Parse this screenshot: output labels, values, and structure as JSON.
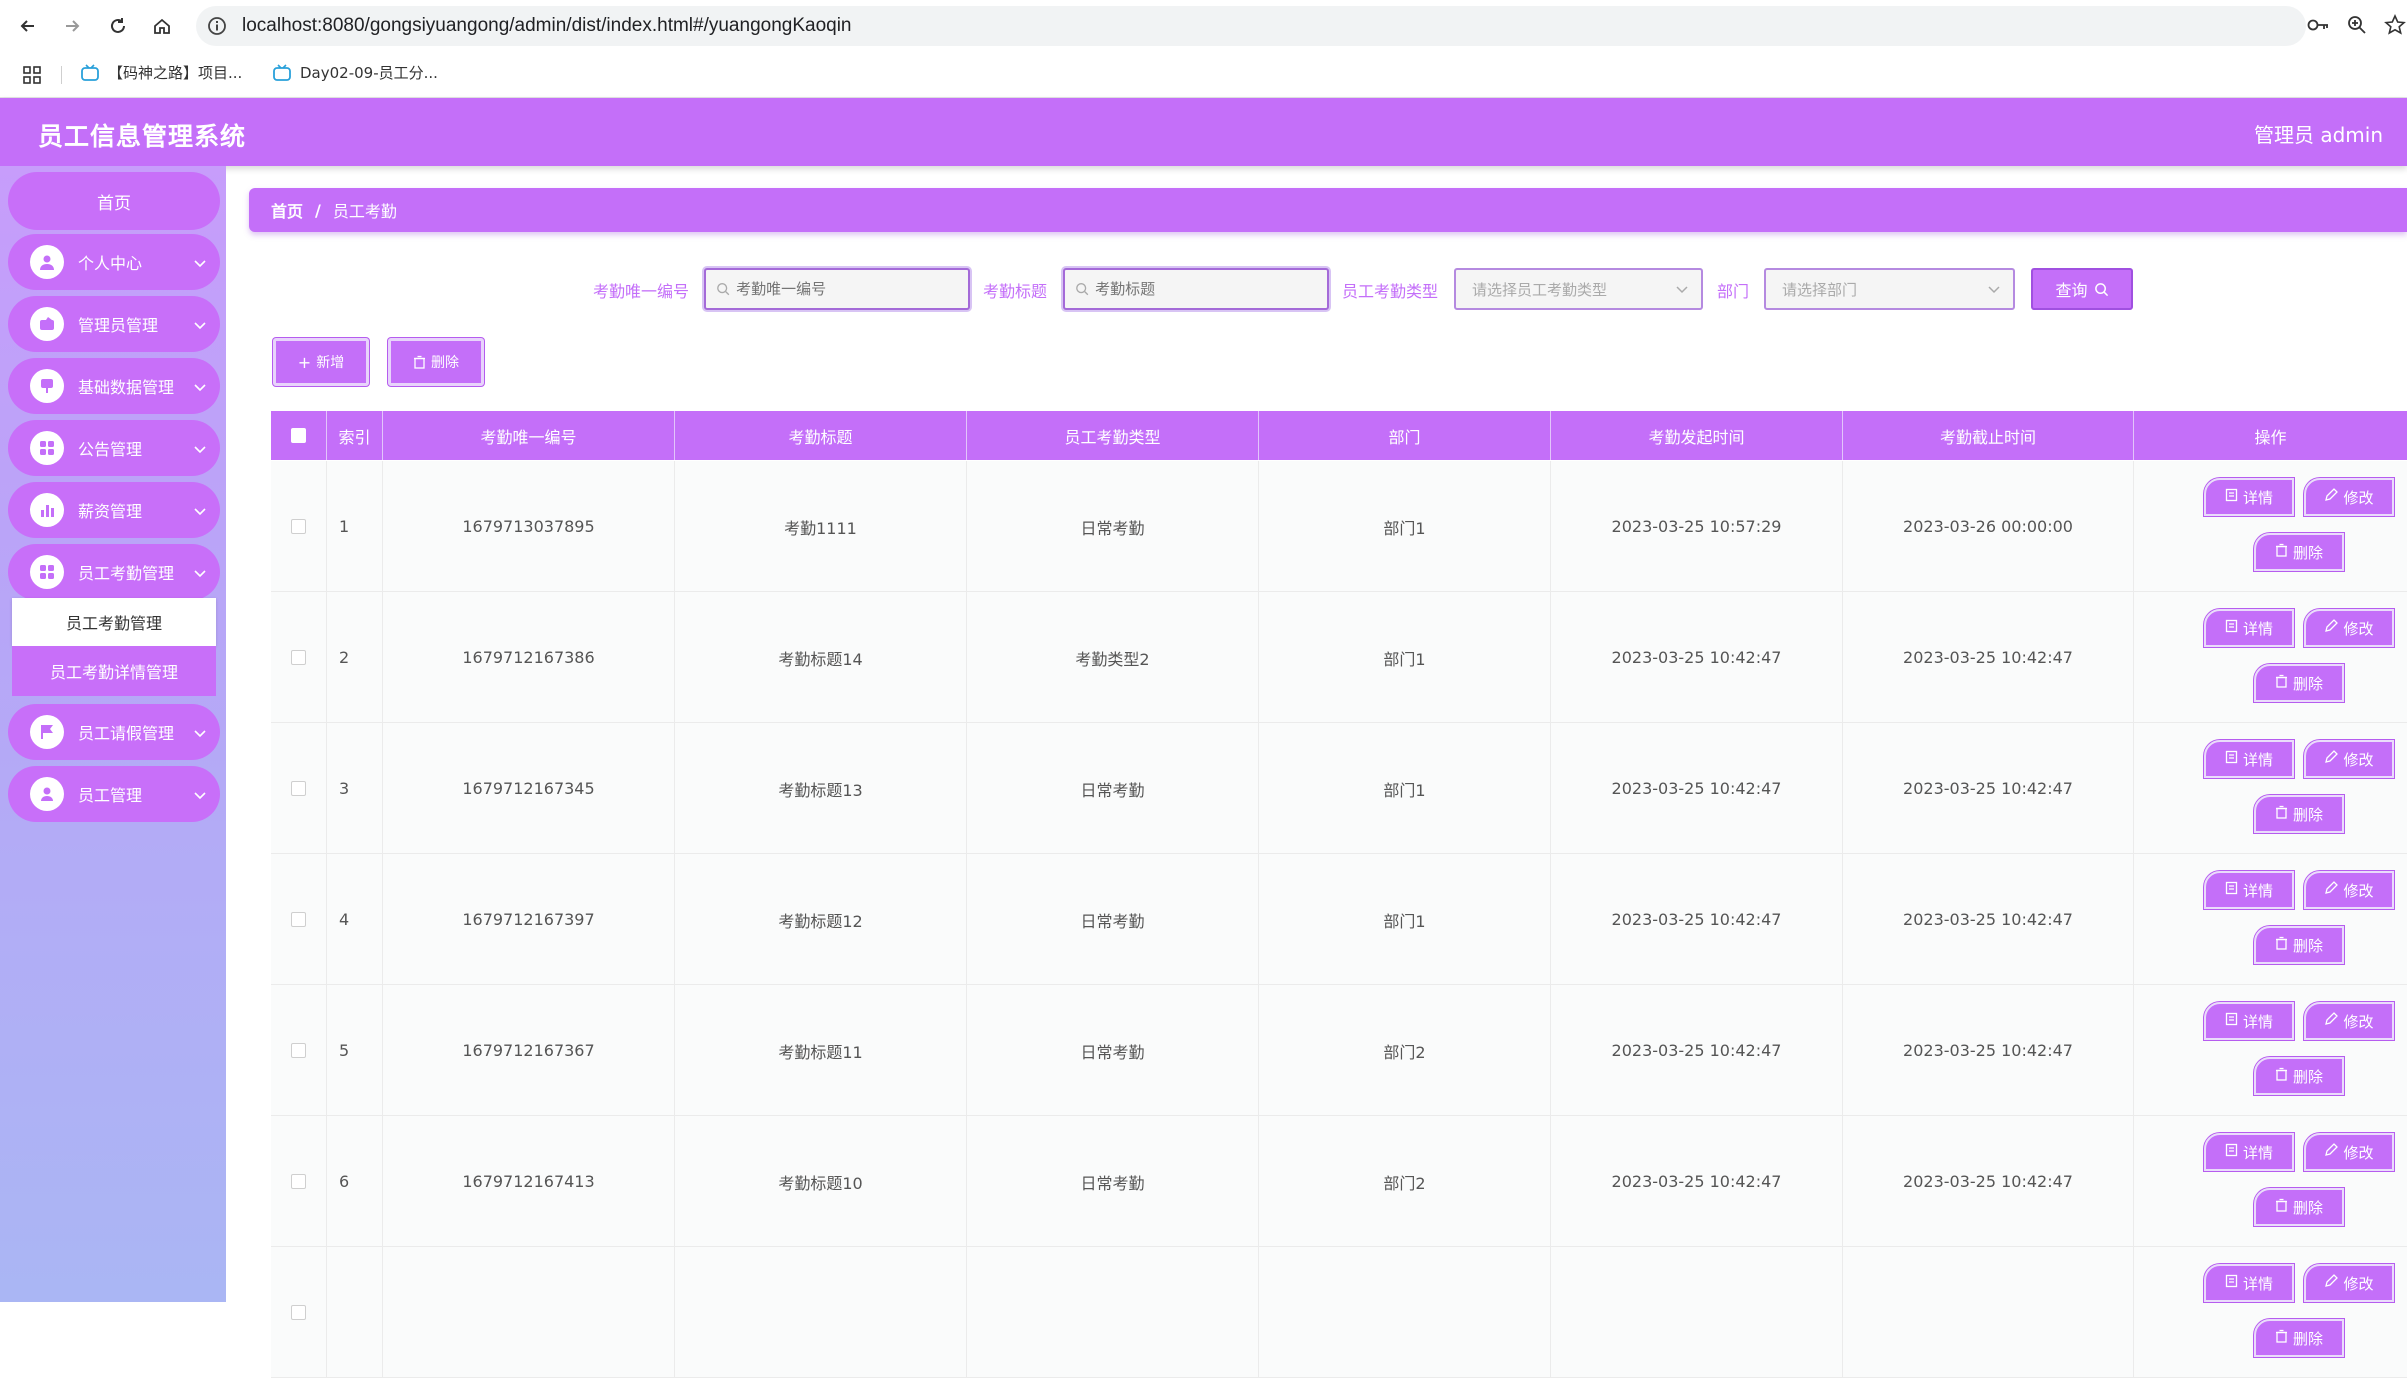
{
  "browser": {
    "url": "localhost:8080/gongsiyuangong/admin/dist/index.html#/yuangongKaoqin",
    "bookmarks": [
      {
        "label": "【码神之路】项目..."
      },
      {
        "label": "Day02-09-员工分..."
      }
    ]
  },
  "header": {
    "title": "员工信息管理系统",
    "user": "管理员 admin"
  },
  "sidebar": {
    "home": "首页",
    "items": [
      {
        "label": "个人中心",
        "icon": "user-icon"
      },
      {
        "label": "管理员管理",
        "icon": "admin-icon"
      },
      {
        "label": "基础数据管理",
        "icon": "data-icon"
      },
      {
        "label": "公告管理",
        "icon": "grid-icon"
      },
      {
        "label": "薪资管理",
        "icon": "chart-icon"
      },
      {
        "label": "员工考勤管理",
        "icon": "grid-icon"
      },
      {
        "label": "员工请假管理",
        "icon": "flag-icon"
      },
      {
        "label": "员工管理",
        "icon": "person-icon"
      }
    ],
    "submenu": [
      "员工考勤管理",
      "员工考勤详情管理"
    ]
  },
  "breadcrumb": {
    "home": "首页",
    "sep": "/",
    "current": "员工考勤"
  },
  "search": {
    "fields": [
      {
        "label": "考勤唯一编号",
        "placeholder": "考勤唯一编号"
      },
      {
        "label": "考勤标题",
        "placeholder": "考勤标题"
      }
    ],
    "selects": [
      {
        "label": "员工考勤类型",
        "placeholder": "请选择员工考勤类型"
      },
      {
        "label": "部门",
        "placeholder": "请选择部门"
      }
    ],
    "button": "查询"
  },
  "actions": {
    "add": "新增",
    "delete": "删除"
  },
  "table": {
    "columns": [
      "索引",
      "考勤唯一编号",
      "考勤标题",
      "员工考勤类型",
      "部门",
      "考勤发起时间",
      "考勤截止时间",
      "操作"
    ],
    "ops": {
      "detail": "详情",
      "edit": "修改",
      "delete": "删除"
    },
    "rows": [
      {
        "index": "1",
        "code": "1679713037895",
        "title": "考勤1111",
        "type": "日常考勤",
        "dept": "部门1",
        "start": "2023-03-25 10:57:29",
        "end": "2023-03-26 00:00:00"
      },
      {
        "index": "2",
        "code": "1679712167386",
        "title": "考勤标题14",
        "type": "考勤类型2",
        "dept": "部门1",
        "start": "2023-03-25 10:42:47",
        "end": "2023-03-25 10:42:47"
      },
      {
        "index": "3",
        "code": "1679712167345",
        "title": "考勤标题13",
        "type": "日常考勤",
        "dept": "部门1",
        "start": "2023-03-25 10:42:47",
        "end": "2023-03-25 10:42:47"
      },
      {
        "index": "4",
        "code": "1679712167397",
        "title": "考勤标题12",
        "type": "日常考勤",
        "dept": "部门1",
        "start": "2023-03-25 10:42:47",
        "end": "2023-03-25 10:42:47"
      },
      {
        "index": "5",
        "code": "1679712167367",
        "title": "考勤标题11",
        "type": "日常考勤",
        "dept": "部门2",
        "start": "2023-03-25 10:42:47",
        "end": "2023-03-25 10:42:47"
      },
      {
        "index": "6",
        "code": "1679712167413",
        "title": "考勤标题10",
        "type": "日常考勤",
        "dept": "部门2",
        "start": "2023-03-25 10:42:47",
        "end": "2023-03-25 10:42:47"
      },
      {
        "index": "",
        "code": "",
        "title": "",
        "type": "",
        "dept": "",
        "start": "",
        "end": ""
      }
    ]
  },
  "colors": {
    "accent": "#c46ff9",
    "sidebar_top": "#c79dfb",
    "sidebar_bottom": "#aab6f4"
  }
}
